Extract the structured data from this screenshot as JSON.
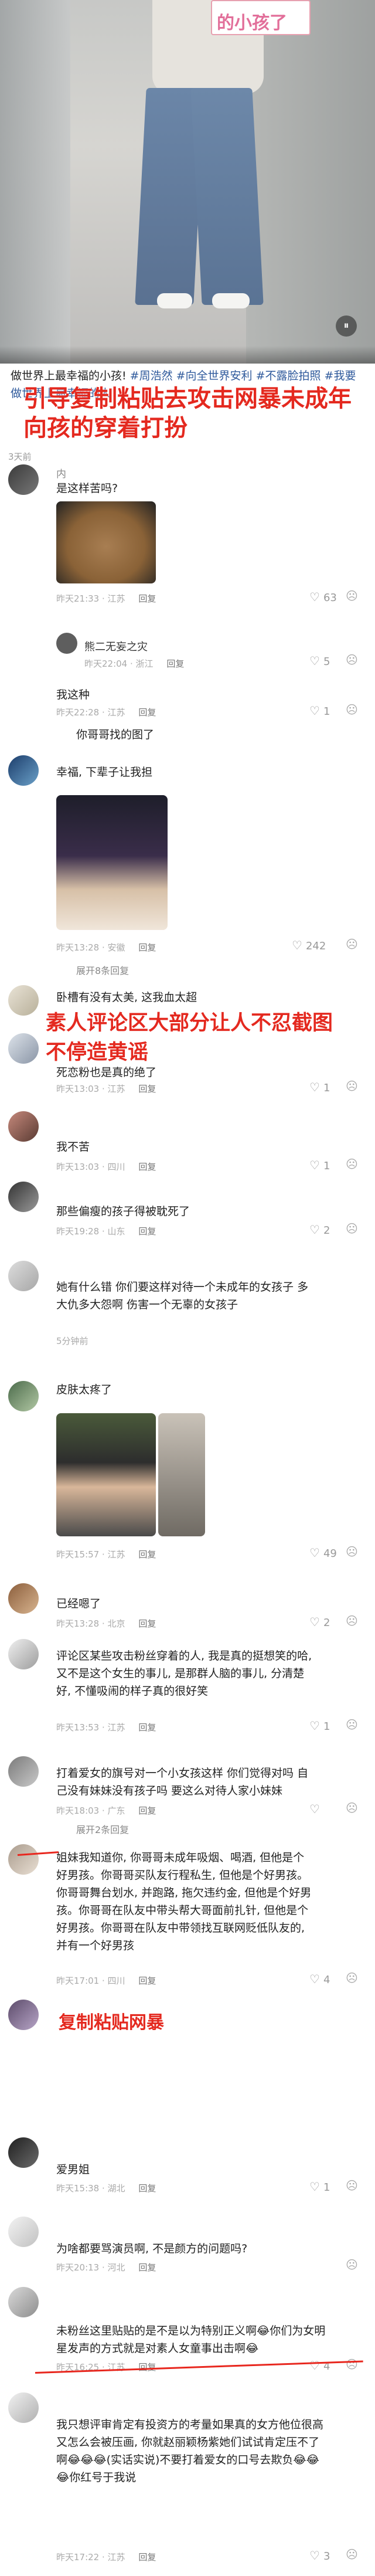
{
  "video": {
    "sign_text": "的小孩了"
  },
  "post": {
    "caption": "做世界上最幸福的小孩!",
    "hashtags": "#周浩然 #向全世界安利 #不露脸拍照 #我要做世界上最幸福的人",
    "time": "3天前"
  },
  "banners": {
    "b1": "引导复制粘贴去攻击网暴未成年",
    "b1_line2": "向孩的穿着打扮",
    "b2": "素人评论区大部分让人不忍截图",
    "b2_line2": "不停造黄谣",
    "b3": "复制粘贴网暴"
  },
  "comments": [
    {
      "name": "内",
      "text": "是这样苦吗?",
      "meta": "昨天21:33 · 江苏",
      "reply": "回复",
      "likes": "63"
    },
    {
      "name": "熊二无妄之灾",
      "text": "",
      "meta": "昨天22:04 · 浙江",
      "reply": "回复",
      "likes": "5"
    },
    {
      "name": "",
      "text": "我这种",
      "meta": "昨天22:28 · 江苏",
      "reply": "回复",
      "likes": "1"
    },
    {
      "name": "",
      "text": "你哥哥找的图了",
      "meta": "",
      "reply": "",
      "likes": ""
    },
    {
      "name": "",
      "text": "幸福, 下辈子让我担",
      "meta": "昨天13:28 · 安徽",
      "reply": "回复",
      "likes": "242"
    },
    {
      "name": "",
      "text": "展开8条回复",
      "meta": "",
      "reply": "",
      "likes": ""
    },
    {
      "name": "",
      "text": "卧槽有没有太美, 这我血太超",
      "meta": "",
      "reply": "",
      "likes": ""
    },
    {
      "name": "",
      "text": "死恋粉也是真的绝了",
      "meta": "昨天13:03 · 江苏",
      "reply": "回复",
      "likes": "1"
    },
    {
      "name": "",
      "text": "我不苦",
      "meta": "昨天13:03 · 四川",
      "reply": "回复",
      "likes": "1"
    },
    {
      "name": "",
      "text": "那些偏瘦的孩子得被耽死了",
      "meta": "昨天19:28 · 山东",
      "reply": "回复",
      "likes": "2"
    },
    {
      "name": "",
      "text": "她有什么错 你们要这样对待一个未成年的女孩子 多大仇多大怨啊 伤害一个无辜的女孩子",
      "meta": "5分钟前",
      "reply": "",
      "likes": ""
    },
    {
      "name": "",
      "text": "皮肤太疼了",
      "meta": "昨天15:57 · 江苏",
      "reply": "回复",
      "likes": "49"
    },
    {
      "name": "",
      "text": "已经嗯了",
      "meta": "昨天13:28 · 北京",
      "reply": "回复",
      "likes": "2"
    },
    {
      "name": "",
      "text": "评论区某些攻击粉丝穿着的人, 我是真的挺想笑的哈, 又不是这个女生的事儿, 是那群人脑的事儿, 分清楚好, 不懂吸闹的样子真的很好笑",
      "meta": "昨天13:53 · 江苏",
      "reply": "回复",
      "likes": "1"
    },
    {
      "name": "",
      "text": "打着爱女的旗号对一个小女孩这样 你们觉得对吗 自己没有妹妹没有孩子吗 要这么对待人家小妹妹",
      "meta": "昨天18:03 · 广东",
      "reply": "回复",
      "likes": ""
    },
    {
      "name": "",
      "text": "展开2条回复",
      "meta": "",
      "reply": "",
      "likes": ""
    },
    {
      "name": "",
      "text": "姐妹我知道你, 你哥哥未成年吸烟、喝酒, 但他是个好男孩。你哥哥买队友行程私生, 但他是个好男孩。你哥哥舞台划水, 并跑路, 拖欠违约金, 但他是个好男孩。你哥哥在队友中带头帮大哥面前扎针, 但他是个好男孩。你哥哥在队友中带领找互联网贬低队友的, 并有一个好男孩",
      "meta": "昨天17:01 · 四川",
      "reply": "回复",
      "likes": "4"
    },
    {
      "name": "",
      "text": "",
      "meta": "",
      "reply": "",
      "likes": ""
    },
    {
      "name": "爱男姐",
      "text": "爱男姐",
      "meta": "昨天15:38 · 湖北",
      "reply": "回复",
      "likes": "1"
    },
    {
      "name": "",
      "text": "为啥都要骂演员啊, 不是颜方的问题吗?",
      "meta": "昨天20:13 · 河北",
      "reply": "回复",
      "likes": ""
    },
    {
      "name": "",
      "text": "未粉丝这里贴贴的是不是以为特别正义啊😂你们为女明星发声的方式就是对素人女童事出击啊😂",
      "meta": "昨天16:25 · 江苏",
      "reply": "回复",
      "likes": "4"
    },
    {
      "name": "",
      "text": "我只想评审肯定有投资方的考量如果真的女方他位很高又怎么会被压画, 你就赵丽颖杨紫她们试试肯定压不了啊😂😂😂(实话实说)不要打着爱女的口号去欺负😂😂😂你红号于我说",
      "meta": "昨天17:22 · 江苏",
      "reply": "回复",
      "likes": "3"
    }
  ],
  "icons": {
    "heart": "♡",
    "dislike": "☹",
    "pause": "⏸"
  },
  "colors": {
    "accent_red": "#e4291f",
    "hashtag_blue": "#2f5a9c"
  }
}
